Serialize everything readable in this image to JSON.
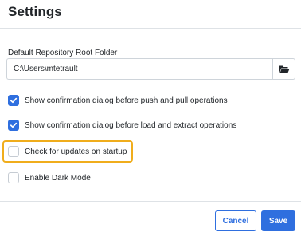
{
  "dialog": {
    "title": "Settings"
  },
  "repository": {
    "label": "Default Repository Root Folder",
    "value": "C:\\Users\\mtetrault",
    "browse_icon": "folder-open-icon"
  },
  "options": [
    {
      "label": "Show confirmation dialog before push and pull operations",
      "checked": true
    },
    {
      "label": "Show confirmation dialog before load and extract operations",
      "checked": true
    },
    {
      "label": "Check for updates on startup",
      "checked": false
    },
    {
      "label": "Enable Dark Mode",
      "checked": false
    }
  ],
  "footer": {
    "cancel_label": "Cancel",
    "save_label": "Save"
  },
  "colors": {
    "accent": "#2f6fdf",
    "highlight": "#f0ad1c"
  }
}
